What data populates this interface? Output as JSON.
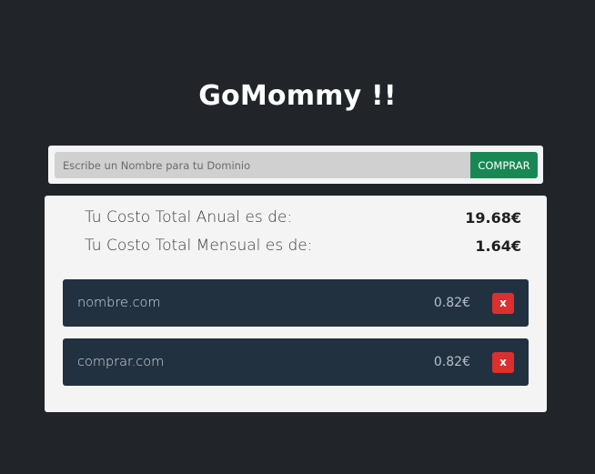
{
  "header": {
    "title": "GoMommy !!"
  },
  "search": {
    "placeholder": "Escribe un Nombre para tu Dominio",
    "value": "",
    "button_label": "COMPRAR"
  },
  "summary": {
    "annual_label": "Tu Costo Total Anual es de:",
    "annual_value": "19.68€",
    "monthly_label": "Tu Costo Total Mensual es de:",
    "monthly_value": "1.64€"
  },
  "domains": [
    {
      "name": "nombre.com",
      "price": "0.82€",
      "remove_label": "x"
    },
    {
      "name": "comprar.com",
      "price": "0.82€",
      "remove_label": "x"
    }
  ],
  "colors": {
    "background": "#212529",
    "panel": "#f4f4f4",
    "buy_button": "#198754",
    "domain_item": "#223140",
    "remove_button": "#dc2f2f"
  }
}
